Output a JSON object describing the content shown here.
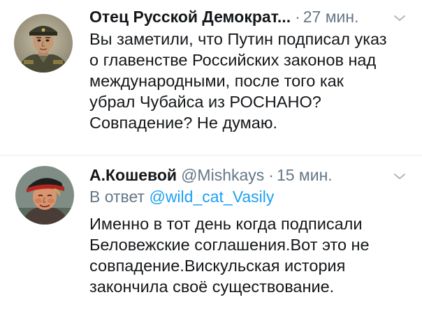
{
  "tweets": [
    {
      "author": {
        "display_name": "Отец Русской Демократ...",
        "handle": "",
        "avatar_icon": "portrait-man-military-cap"
      },
      "separator": "·",
      "time": "27 мин.",
      "reply_to": null,
      "text_lines": [
        "Вы заметили, что Путин подписал указ",
        "о главенстве Российских законов над",
        "международными, после того как",
        "убрал Чубайса из РОСНАНО?",
        "Совпадение? Не думаю."
      ],
      "menu_icon": "chevron-down-icon"
    },
    {
      "author": {
        "display_name": "А.Кошевой",
        "handle": "@Mishkays",
        "avatar_icon": "portrait-man-cossack-cap"
      },
      "separator": "·",
      "time": "15 мин.",
      "reply_to": {
        "prefix": "В ответ",
        "handle": "@wild_cat_Vasily"
      },
      "text_lines": [
        "Именно в тот день когда подписали",
        "Беловежские соглашения.Вот это не",
        "совпадение.Вискульская история",
        "закончила своё существование."
      ],
      "menu_icon": "chevron-down-icon"
    }
  ],
  "colors": {
    "text": "#14171a",
    "secondary": "#657786",
    "link": "#1da1f2",
    "divider": "#e6ecf0"
  }
}
